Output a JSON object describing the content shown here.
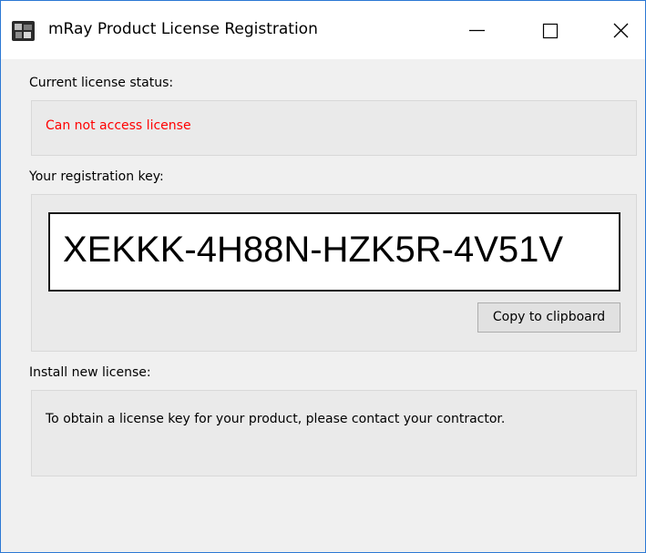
{
  "window": {
    "title": "mRay Product License Registration",
    "app_icon": "mray-app-icon",
    "controls": [
      "minimize-icon",
      "maximize-icon",
      "close-icon"
    ]
  },
  "license_status": {
    "label": "Current license status:",
    "value": "Can not access license",
    "value_color": "#ff0000"
  },
  "registration": {
    "label": "Your registration key:",
    "key": "XEKKK-4H88N-HZK5R-4V51V",
    "copy_button_label": "Copy to clipboard"
  },
  "install": {
    "label": "Install new license:",
    "info": "To obtain a license key for your product, please contact your contractor."
  },
  "colors": {
    "window_border": "#2b78d4",
    "background": "#f0f0f0"
  }
}
